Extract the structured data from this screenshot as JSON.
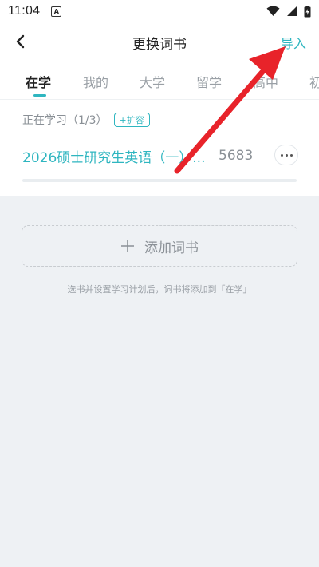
{
  "status_bar": {
    "time": "11:04",
    "notification_icon": "A"
  },
  "header": {
    "title": "更换词书",
    "import_label": "导入"
  },
  "tabs": [
    {
      "label": "在学",
      "active": true
    },
    {
      "label": "我的",
      "active": false
    },
    {
      "label": "大学",
      "active": false
    },
    {
      "label": "留学",
      "active": false
    },
    {
      "label": "高中",
      "active": false
    },
    {
      "label": "初",
      "active": false
    }
  ],
  "studying": {
    "section_label": "正在学习（1/3）",
    "expand_label": "+扩容",
    "book": {
      "title": "2026硕士研究生英语（一）...",
      "word_count": "5683",
      "progress": 0.0
    }
  },
  "add_book": {
    "label": "添加词书"
  },
  "hint": "选书并设置学习计划后，词书将添加到「在学」",
  "colors": {
    "accent": "#2fb6c0",
    "annotation_arrow": "#e8232a",
    "background_grey": "#eef1f4"
  }
}
